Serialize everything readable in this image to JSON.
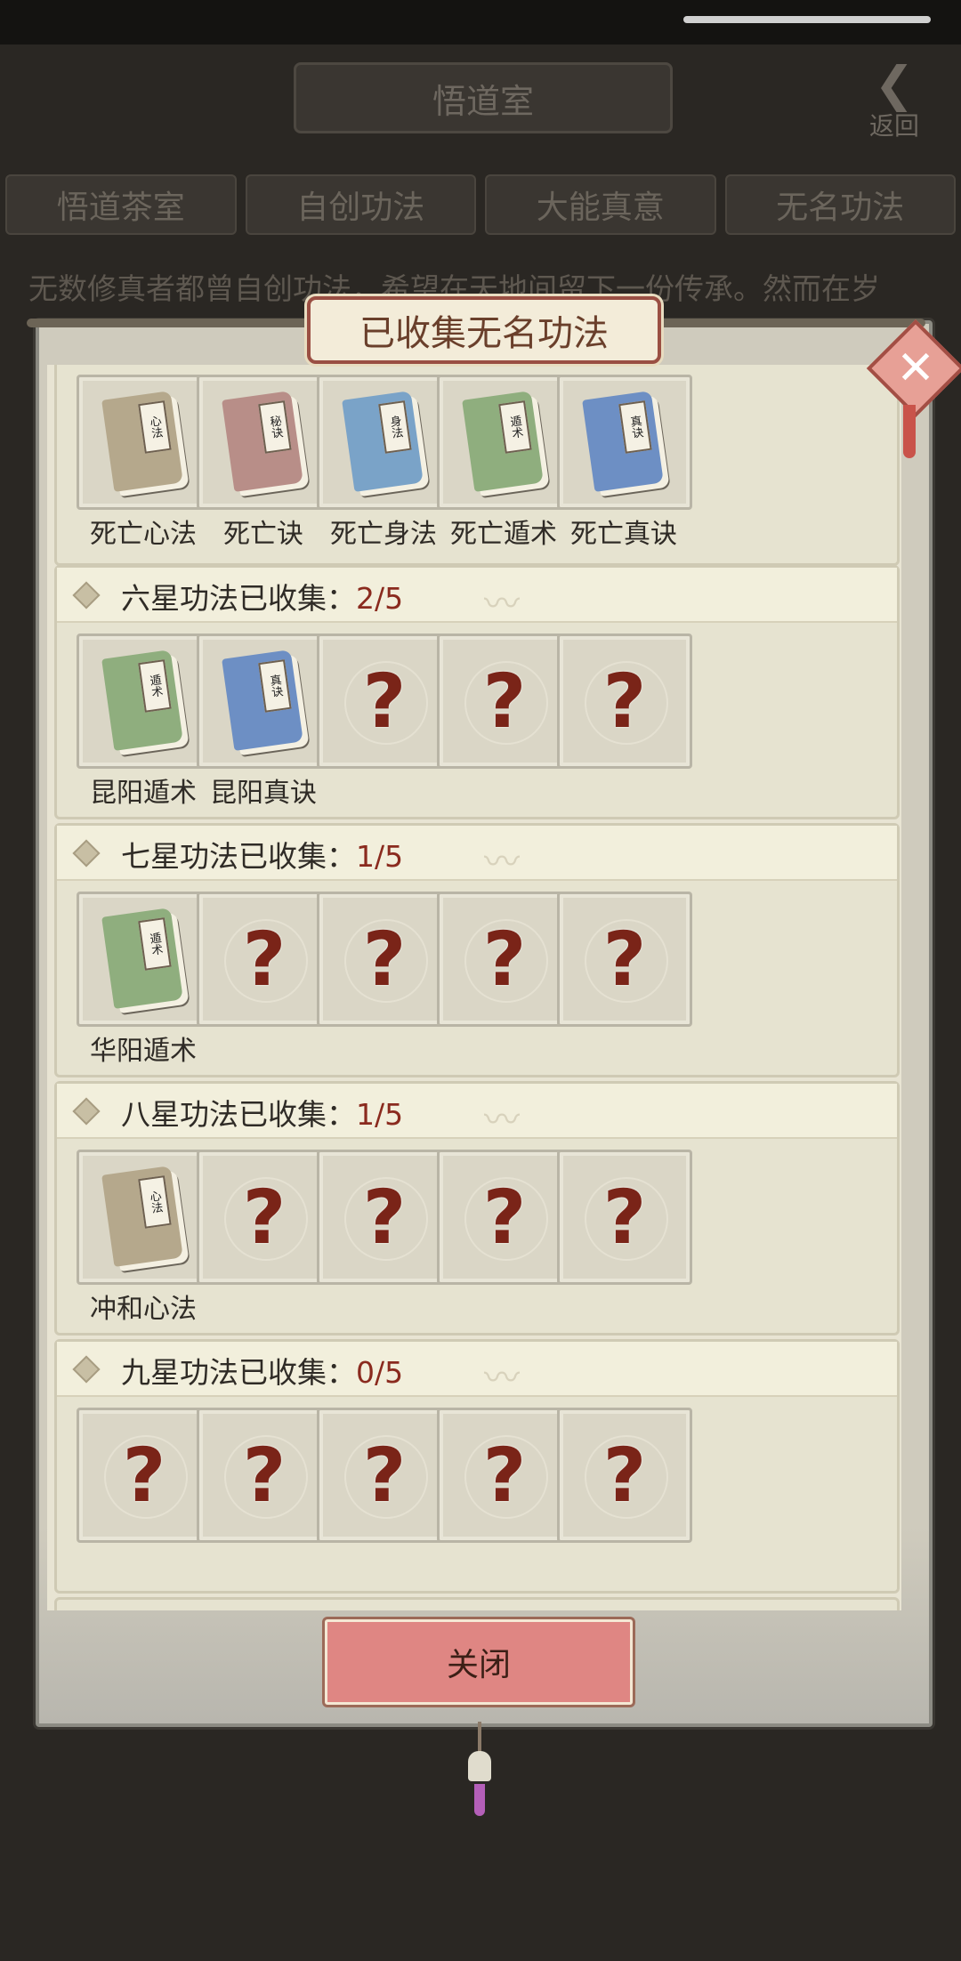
{
  "background": {
    "title": "悟道室",
    "back_label": "返回",
    "tabs": [
      "悟道茶室",
      "自创功法",
      "大能真意",
      "无名功法"
    ],
    "description": "无数修真者都曾自创功法，希望在天地间留下一份传承。然而在岁"
  },
  "modal": {
    "title": "已收集无名功法",
    "close_label": "关闭",
    "unknown_glyph": "?"
  },
  "top_row": [
    {
      "name": "死亡心法",
      "book_color": "#b5a88c",
      "book_label": "心法"
    },
    {
      "name": "死亡诀",
      "book_color": "#b88e88",
      "book_label": "秘诀"
    },
    {
      "name": "死亡身法",
      "book_color": "#7aa3c8",
      "book_label": "身法"
    },
    {
      "name": "死亡遁术",
      "book_color": "#8fae7e",
      "book_label": "遁术"
    },
    {
      "name": "死亡真诀",
      "book_color": "#6d8fc4",
      "book_label": "真诀"
    }
  ],
  "groups": [
    {
      "title": "六星功法已收集：",
      "count": "2/5",
      "items": [
        {
          "name": "昆阳遁术",
          "book_color": "#8fae7e",
          "book_label": "遁术"
        },
        {
          "name": "昆阳真诀",
          "book_color": "#6d8fc4",
          "book_label": "真诀"
        },
        null,
        null,
        null
      ]
    },
    {
      "title": "七星功法已收集：",
      "count": "1/5",
      "items": [
        {
          "name": "华阳遁术",
          "book_color": "#8fae7e",
          "book_label": "遁术"
        },
        null,
        null,
        null,
        null
      ]
    },
    {
      "title": "八星功法已收集：",
      "count": "1/5",
      "items": [
        {
          "name": "冲和心法",
          "book_color": "#b5a88c",
          "book_label": "心法"
        },
        null,
        null,
        null,
        null
      ]
    },
    {
      "title": "九星功法已收集：",
      "count": "0/5",
      "items": [
        null,
        null,
        null,
        null,
        null
      ]
    }
  ]
}
